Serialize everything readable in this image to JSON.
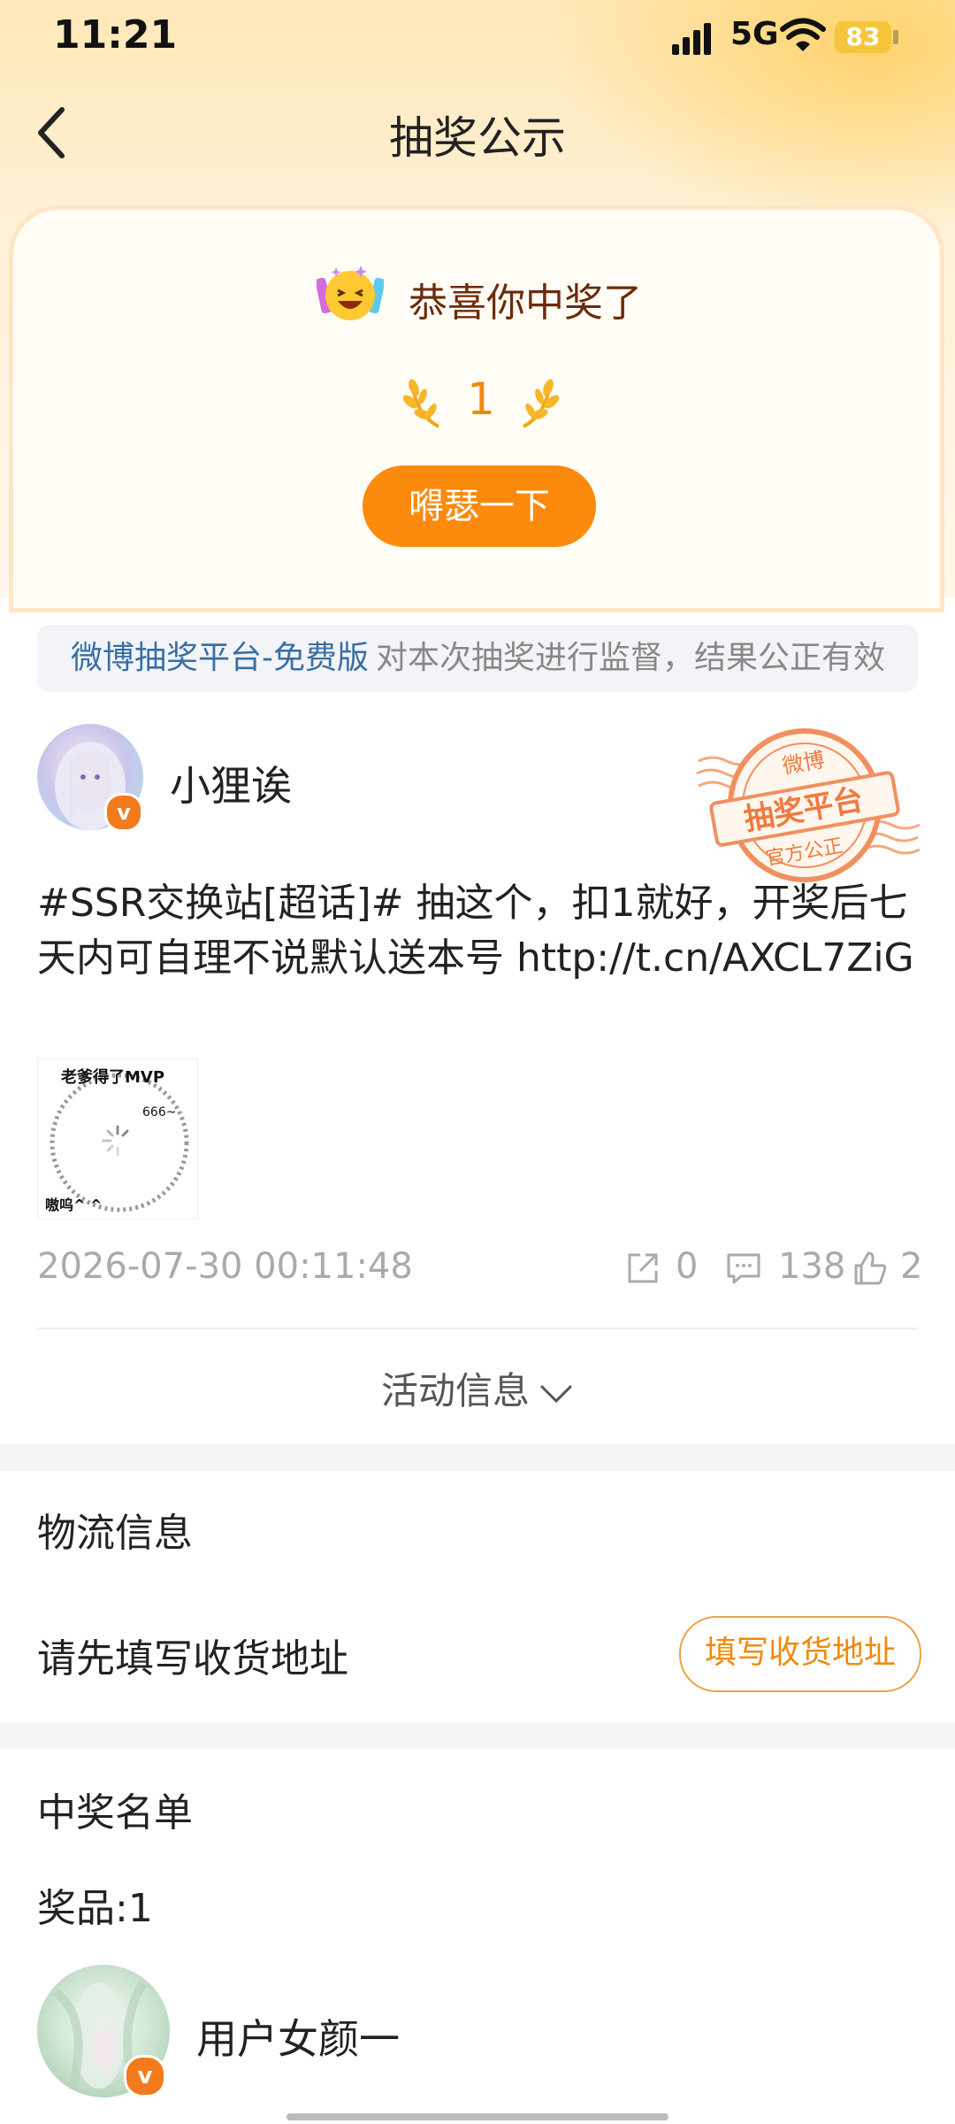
{
  "status_bar": {
    "time": "11:21",
    "network": "5G",
    "battery": "83"
  },
  "nav": {
    "title": "抽奖公示"
  },
  "win_card": {
    "congrats": "恭喜你中奖了",
    "count": "1",
    "share_button": "嘚瑟一下"
  },
  "notice": {
    "platform_link": "微博抽奖平台-免费版",
    "text": "对本次抽奖进行监督，结果公正有效"
  },
  "stamp": {
    "top": "微博",
    "middle": "抽奖平台",
    "bottom": "官方公正"
  },
  "post": {
    "username": "小狸诶",
    "text": "#SSR交换站[超话]# 抽这个，扣1就好，开奖后七天内可自理不说默认送本号  http://t.cn/AXCL7ZiG",
    "image_text_top": "老爹得了MVP",
    "image_text_right": "666~",
    "image_text_bottom": "嗷呜^ ^",
    "timestamp": "2026-07-30 00:11:48",
    "reposts": "0",
    "comments": "138",
    "likes": "2"
  },
  "activity": {
    "label": "活动信息"
  },
  "logistics": {
    "title": "物流信息",
    "prompt": "请先填写收货地址",
    "button": "填写收货地址"
  },
  "winners": {
    "title": "中奖名单",
    "prize": "奖品:1",
    "winner_name": "用户女颜一"
  },
  "colors": {
    "accent": "#fc8a0c",
    "link": "#3a6ea5",
    "badge": "#f37b1d"
  }
}
